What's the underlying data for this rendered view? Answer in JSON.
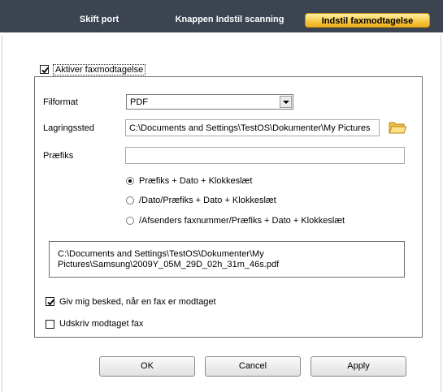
{
  "tabs": [
    {
      "label": "Skift port",
      "active": false
    },
    {
      "label": "Knappen Indstil scanning",
      "active": false
    },
    {
      "label": "Indstil faxmodtagelse",
      "active": true
    }
  ],
  "enable": {
    "label": "Aktiver faxmodtagelse",
    "checked": true
  },
  "fileformat": {
    "label": "Filformat",
    "value": "PDF"
  },
  "storage": {
    "label": "Lagringssted",
    "value": "C:\\Documents and Settings\\TestOS\\Dokumenter\\My Pictures"
  },
  "prefix": {
    "label": "Præfiks",
    "value": ""
  },
  "naming_options": [
    {
      "label": "Præfiks + Dato + Klokkeslæt",
      "selected": true
    },
    {
      "label": "/Dato/Præfiks + Dato + Klokkeslæt",
      "selected": false
    },
    {
      "label": "/Afsenders faxnummer/Præfiks + Dato + Klokkeslæt",
      "selected": false
    }
  ],
  "preview": {
    "line1": "C:\\Documents and Settings\\TestOS\\Dokumenter\\My",
    "line2": "Pictures\\Samsung\\2009Y_05M_29D_02h_31m_46s.pdf"
  },
  "notify": {
    "label": "Giv mig besked, når en fax er modtaget",
    "checked": true
  },
  "print": {
    "label": "Udskriv modtaget fax",
    "checked": false
  },
  "buttons": {
    "ok": "OK",
    "cancel": "Cancel",
    "apply": "Apply"
  },
  "colors": {
    "tabbar": "#3c4452",
    "active_tab": "#f6c640"
  }
}
